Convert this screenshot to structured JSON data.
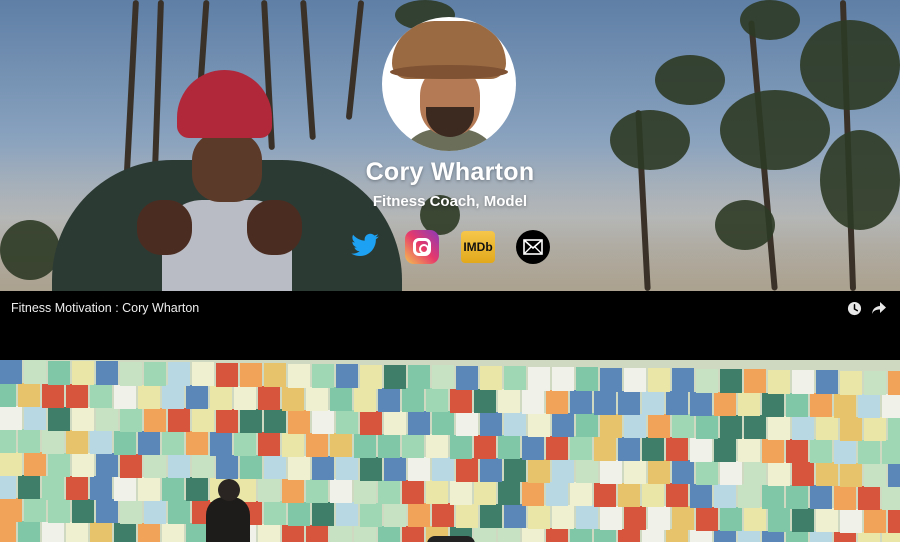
{
  "profile": {
    "name": "Cory Wharton",
    "tagline": "Fitness Coach, Model",
    "social": [
      {
        "id": "twitter",
        "icon": "twitter-icon",
        "color": "#1da1f2"
      },
      {
        "id": "instagram",
        "icon": "instagram-icon",
        "color": "#e6396b"
      },
      {
        "id": "imdb",
        "icon": "imdb-icon",
        "label": "IMDb",
        "color": "#f5c518"
      },
      {
        "id": "email",
        "icon": "mail-icon",
        "color": "#000000"
      }
    ]
  },
  "video": {
    "title": "Fitness Motivation : Cory Wharton",
    "actions": [
      {
        "id": "watch-later",
        "icon": "clock-icon"
      },
      {
        "id": "share",
        "icon": "share-icon"
      }
    ]
  },
  "colors": {
    "background": "#000000",
    "text": "#ffffff"
  }
}
